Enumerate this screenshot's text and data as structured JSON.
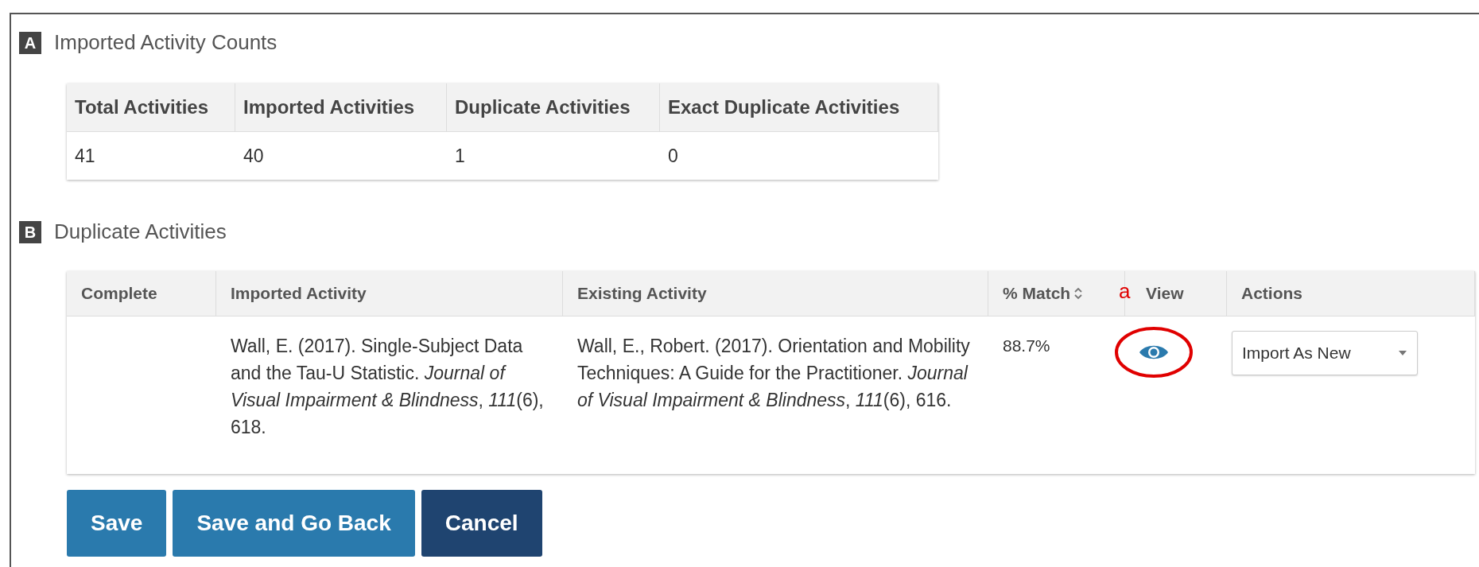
{
  "sections": [
    {
      "badge": "A",
      "title": "Imported Activity Counts"
    },
    {
      "badge": "B",
      "title": "Duplicate Activities"
    }
  ],
  "counts_table": {
    "columns": [
      "Total Activities",
      "Imported Activities",
      "Duplicate Activities",
      "Exact Duplicate Activities"
    ],
    "rows": [
      [
        "41",
        "40",
        "1",
        "0"
      ]
    ]
  },
  "duplicates_table": {
    "columns": [
      {
        "label": "Complete",
        "sortable": false
      },
      {
        "label": "Imported Activity",
        "sortable": false
      },
      {
        "label": "Existing Activity",
        "sortable": false
      },
      {
        "label": "% Match",
        "sortable": true
      },
      {
        "label": "View",
        "sortable": false
      },
      {
        "label": "Actions",
        "sortable": false
      }
    ],
    "rows": [
      {
        "imported": "Wall, E. (2017). Single-Subject Data and the Tau-U Statistic. *Journal of Visual Impairment & Blindness*, *111*(6), 618.",
        "existing": "Wall, E., Robert. (2017). Orientation and Mobility Techniques: A Guide for the Practitioner. *Journal of Visual Impairment & Blindness*, *111*(6), 616.",
        "match": "88.7%",
        "action": "Import As New"
      }
    ]
  },
  "annotation": {
    "label": "a"
  },
  "buttons": [
    {
      "label": "Save",
      "kind": "primary"
    },
    {
      "label": "Save and Go Back",
      "kind": "primary"
    },
    {
      "label": "Cancel",
      "kind": "dark"
    }
  ]
}
